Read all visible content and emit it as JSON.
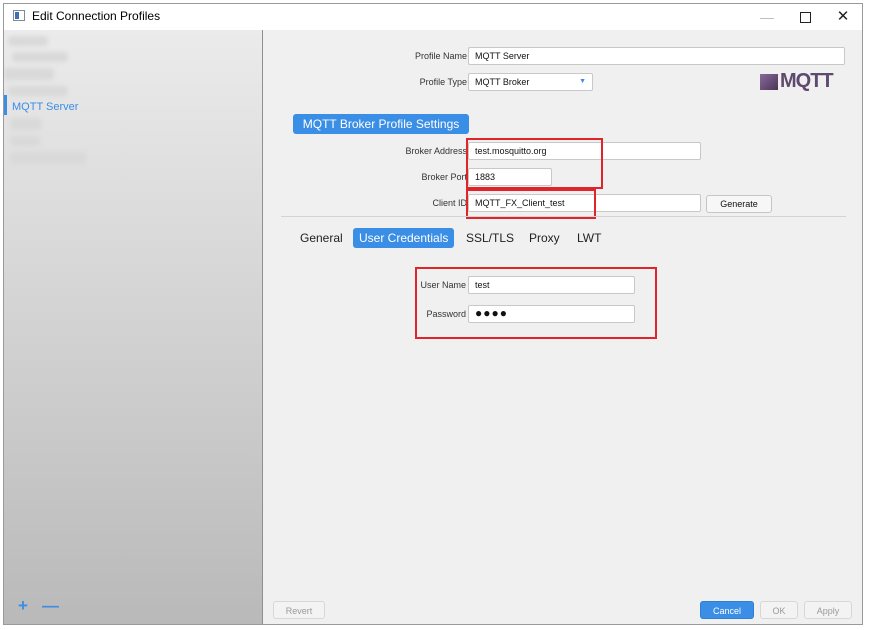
{
  "window": {
    "title": "Edit Connection Profiles",
    "minimize": "—",
    "close": "✕"
  },
  "sidebar": {
    "selected_item": "MQTT Server",
    "add_label": "+",
    "remove_label": "—"
  },
  "profile": {
    "name_label": "Profile Name",
    "name_value": "MQTT Server",
    "type_label": "Profile Type",
    "type_value": "MQTT Broker",
    "logo_text": "MQTT"
  },
  "broker_settings": {
    "section_title": "MQTT Broker Profile Settings",
    "address_label": "Broker Address",
    "address_value": "test.mosquitto.org",
    "port_label": "Broker Port",
    "port_value": "1883",
    "client_id_label": "Client ID",
    "client_id_value": "MQTT_FX_Client_test",
    "generate_label": "Generate"
  },
  "tabs": [
    "General",
    "User Credentials",
    "SSL/TLS",
    "Proxy",
    "LWT"
  ],
  "active_tab": "User Credentials",
  "credentials": {
    "user_label": "User Name",
    "user_value": "test",
    "password_label": "Password",
    "password_value": "●●●●"
  },
  "footer": {
    "revert_label": "Revert",
    "cancel_label": "Cancel",
    "ok_label": "OK",
    "apply_label": "Apply"
  },
  "colors": {
    "accent": "#3a8ee6",
    "annotation_red": "#e0242c"
  }
}
